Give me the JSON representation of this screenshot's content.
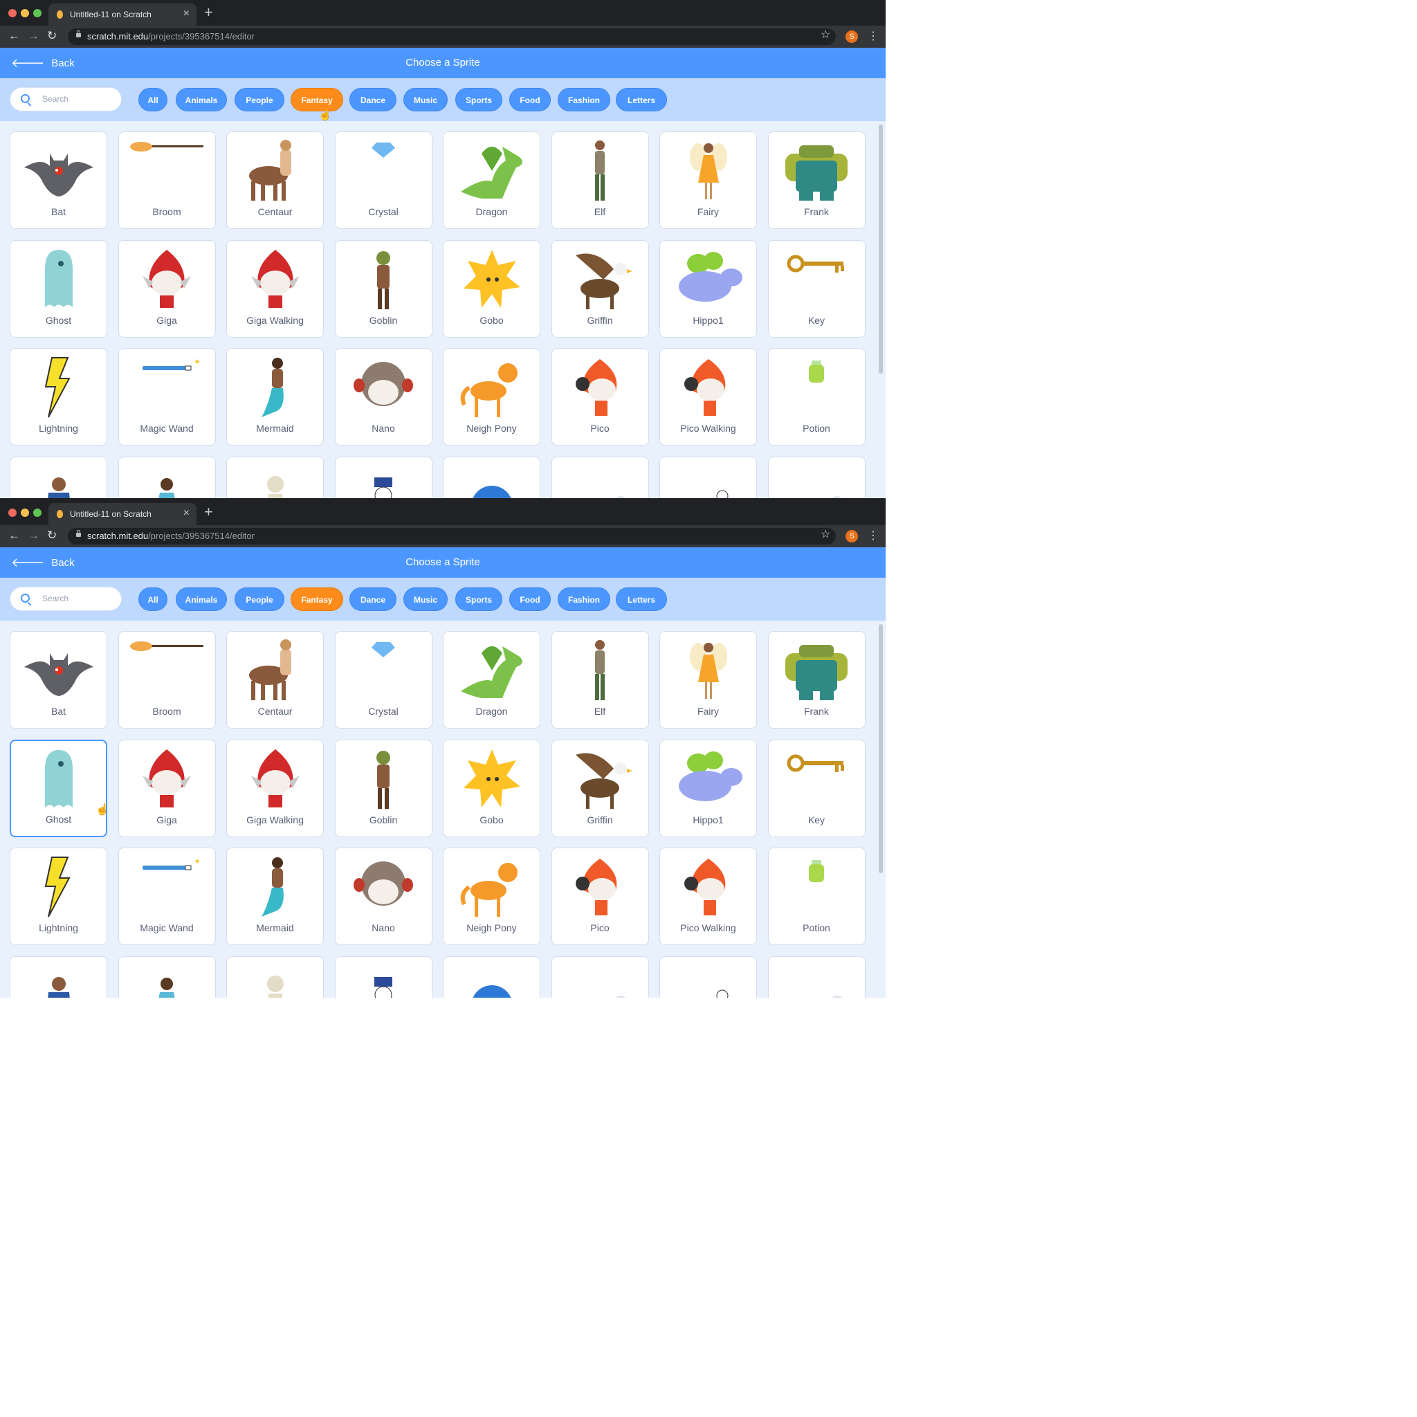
{
  "browser": {
    "tab_title": "Untitled-11 on Scratch",
    "url_host": "scratch.mit.edu",
    "url_path": "/projects/395367514/editor",
    "profile_initial": "S"
  },
  "header": {
    "back_label": "Back",
    "title": "Choose a Sprite"
  },
  "search": {
    "placeholder": "Search"
  },
  "tags": [
    "All",
    "Animals",
    "People",
    "Fantasy",
    "Dance",
    "Music",
    "Sports",
    "Food",
    "Fashion",
    "Letters"
  ],
  "active_tag": "Fantasy",
  "sprites": [
    {
      "name": "Bat",
      "icon": "bat-sprite-icon",
      "color": "#5f5f66"
    },
    {
      "name": "Broom",
      "icon": "broom-sprite-icon",
      "color": "#f2a94a"
    },
    {
      "name": "Centaur",
      "icon": "centaur-sprite-icon",
      "color": "#8a5a3c"
    },
    {
      "name": "Crystal",
      "icon": "crystal-sprite-icon",
      "color": "#6fb8f2"
    },
    {
      "name": "Dragon",
      "icon": "dragon-sprite-icon",
      "color": "#7cc24a"
    },
    {
      "name": "Elf",
      "icon": "elf-sprite-icon",
      "color": "#4f6b3f"
    },
    {
      "name": "Fairy",
      "icon": "fairy-sprite-icon",
      "color": "#f7a52a"
    },
    {
      "name": "Frank",
      "icon": "frank-sprite-icon",
      "color": "#2f8a86"
    },
    {
      "name": "Ghost",
      "icon": "ghost-sprite-icon",
      "color": "#8fd3d5"
    },
    {
      "name": "Giga",
      "icon": "giga-sprite-icon",
      "color": "#d22a2a"
    },
    {
      "name": "Giga Walking",
      "icon": "giga-walking-sprite-icon",
      "color": "#d22a2a"
    },
    {
      "name": "Goblin",
      "icon": "goblin-sprite-icon",
      "color": "#7a8f3c"
    },
    {
      "name": "Gobo",
      "icon": "gobo-sprite-icon",
      "color": "#ffc224"
    },
    {
      "name": "Griffin",
      "icon": "griffin-sprite-icon",
      "color": "#6b4a2b"
    },
    {
      "name": "Hippo1",
      "icon": "hippo-sprite-icon",
      "color": "#9aa6ef"
    },
    {
      "name": "Key",
      "icon": "key-sprite-icon",
      "color": "#c8921f"
    },
    {
      "name": "Lightning",
      "icon": "lightning-sprite-icon",
      "color": "#f6e02a"
    },
    {
      "name": "Magic Wand",
      "icon": "magic-wand-sprite-icon",
      "color": "#3d8fd6"
    },
    {
      "name": "Mermaid",
      "icon": "mermaid-sprite-icon",
      "color": "#39b9c8"
    },
    {
      "name": "Nano",
      "icon": "nano-sprite-icon",
      "color": "#8d7b6f"
    },
    {
      "name": "Neigh Pony",
      "icon": "neigh-pony-sprite-icon",
      "color": "#f59a2a"
    },
    {
      "name": "Pico",
      "icon": "pico-sprite-icon",
      "color": "#f05a28"
    },
    {
      "name": "Pico Walking",
      "icon": "pico-walking-sprite-icon",
      "color": "#f05a28"
    },
    {
      "name": "Potion",
      "icon": "potion-sprite-icon",
      "color": "#a9d84a"
    },
    {
      "name": "",
      "icon": "prince-sprite-icon",
      "color": "#2b5aa6"
    },
    {
      "name": "",
      "icon": "princess-sprite-icon",
      "color": "#58b8d6"
    },
    {
      "name": "",
      "icon": "skeleton-sprite-icon",
      "color": "#e4dcc6"
    },
    {
      "name": "",
      "icon": "snowman-sprite-icon",
      "color": "#2d8a3e"
    },
    {
      "name": "",
      "icon": "blue-creature-sprite-icon",
      "color": "#2f79d6"
    },
    {
      "name": "",
      "icon": "unicorn-sprite-icon",
      "color": "#dde3ec"
    },
    {
      "name": "",
      "icon": "unicorn-running-sprite-icon",
      "color": "#f2c232"
    },
    {
      "name": "",
      "icon": "unicorn-flying-sprite-icon",
      "color": "#dde3ec"
    }
  ],
  "frames": [
    {
      "selected_sprite": null
    },
    {
      "selected_sprite": "Ghost"
    }
  ]
}
